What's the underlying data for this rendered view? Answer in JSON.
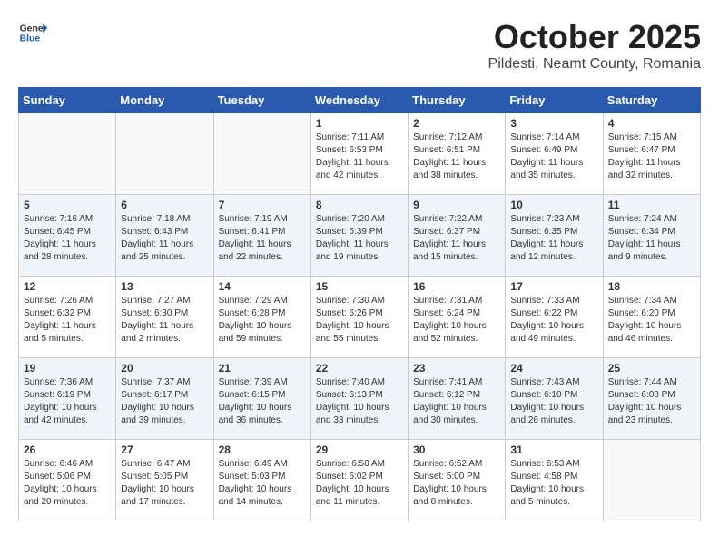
{
  "logo": {
    "general": "General",
    "blue": "Blue"
  },
  "title": "October 2025",
  "location": "Pildesti, Neamt County, Romania",
  "weekdays": [
    "Sunday",
    "Monday",
    "Tuesday",
    "Wednesday",
    "Thursday",
    "Friday",
    "Saturday"
  ],
  "weeks": [
    [
      {
        "day": "",
        "text": ""
      },
      {
        "day": "",
        "text": ""
      },
      {
        "day": "",
        "text": ""
      },
      {
        "day": "1",
        "text": "Sunrise: 7:11 AM\nSunset: 6:53 PM\nDaylight: 11 hours\nand 42 minutes."
      },
      {
        "day": "2",
        "text": "Sunrise: 7:12 AM\nSunset: 6:51 PM\nDaylight: 11 hours\nand 38 minutes."
      },
      {
        "day": "3",
        "text": "Sunrise: 7:14 AM\nSunset: 6:49 PM\nDaylight: 11 hours\nand 35 minutes."
      },
      {
        "day": "4",
        "text": "Sunrise: 7:15 AM\nSunset: 6:47 PM\nDaylight: 11 hours\nand 32 minutes."
      }
    ],
    [
      {
        "day": "5",
        "text": "Sunrise: 7:16 AM\nSunset: 6:45 PM\nDaylight: 11 hours\nand 28 minutes."
      },
      {
        "day": "6",
        "text": "Sunrise: 7:18 AM\nSunset: 6:43 PM\nDaylight: 11 hours\nand 25 minutes."
      },
      {
        "day": "7",
        "text": "Sunrise: 7:19 AM\nSunset: 6:41 PM\nDaylight: 11 hours\nand 22 minutes."
      },
      {
        "day": "8",
        "text": "Sunrise: 7:20 AM\nSunset: 6:39 PM\nDaylight: 11 hours\nand 19 minutes."
      },
      {
        "day": "9",
        "text": "Sunrise: 7:22 AM\nSunset: 6:37 PM\nDaylight: 11 hours\nand 15 minutes."
      },
      {
        "day": "10",
        "text": "Sunrise: 7:23 AM\nSunset: 6:35 PM\nDaylight: 11 hours\nand 12 minutes."
      },
      {
        "day": "11",
        "text": "Sunrise: 7:24 AM\nSunset: 6:34 PM\nDaylight: 11 hours\nand 9 minutes."
      }
    ],
    [
      {
        "day": "12",
        "text": "Sunrise: 7:26 AM\nSunset: 6:32 PM\nDaylight: 11 hours\nand 5 minutes."
      },
      {
        "day": "13",
        "text": "Sunrise: 7:27 AM\nSunset: 6:30 PM\nDaylight: 11 hours\nand 2 minutes."
      },
      {
        "day": "14",
        "text": "Sunrise: 7:29 AM\nSunset: 6:28 PM\nDaylight: 10 hours\nand 59 minutes."
      },
      {
        "day": "15",
        "text": "Sunrise: 7:30 AM\nSunset: 6:26 PM\nDaylight: 10 hours\nand 55 minutes."
      },
      {
        "day": "16",
        "text": "Sunrise: 7:31 AM\nSunset: 6:24 PM\nDaylight: 10 hours\nand 52 minutes."
      },
      {
        "day": "17",
        "text": "Sunrise: 7:33 AM\nSunset: 6:22 PM\nDaylight: 10 hours\nand 49 minutes."
      },
      {
        "day": "18",
        "text": "Sunrise: 7:34 AM\nSunset: 6:20 PM\nDaylight: 10 hours\nand 46 minutes."
      }
    ],
    [
      {
        "day": "19",
        "text": "Sunrise: 7:36 AM\nSunset: 6:19 PM\nDaylight: 10 hours\nand 42 minutes."
      },
      {
        "day": "20",
        "text": "Sunrise: 7:37 AM\nSunset: 6:17 PM\nDaylight: 10 hours\nand 39 minutes."
      },
      {
        "day": "21",
        "text": "Sunrise: 7:39 AM\nSunset: 6:15 PM\nDaylight: 10 hours\nand 36 minutes."
      },
      {
        "day": "22",
        "text": "Sunrise: 7:40 AM\nSunset: 6:13 PM\nDaylight: 10 hours\nand 33 minutes."
      },
      {
        "day": "23",
        "text": "Sunrise: 7:41 AM\nSunset: 6:12 PM\nDaylight: 10 hours\nand 30 minutes."
      },
      {
        "day": "24",
        "text": "Sunrise: 7:43 AM\nSunset: 6:10 PM\nDaylight: 10 hours\nand 26 minutes."
      },
      {
        "day": "25",
        "text": "Sunrise: 7:44 AM\nSunset: 6:08 PM\nDaylight: 10 hours\nand 23 minutes."
      }
    ],
    [
      {
        "day": "26",
        "text": "Sunrise: 6:46 AM\nSunset: 5:06 PM\nDaylight: 10 hours\nand 20 minutes."
      },
      {
        "day": "27",
        "text": "Sunrise: 6:47 AM\nSunset: 5:05 PM\nDaylight: 10 hours\nand 17 minutes."
      },
      {
        "day": "28",
        "text": "Sunrise: 6:49 AM\nSunset: 5:03 PM\nDaylight: 10 hours\nand 14 minutes."
      },
      {
        "day": "29",
        "text": "Sunrise: 6:50 AM\nSunset: 5:02 PM\nDaylight: 10 hours\nand 11 minutes."
      },
      {
        "day": "30",
        "text": "Sunrise: 6:52 AM\nSunset: 5:00 PM\nDaylight: 10 hours\nand 8 minutes."
      },
      {
        "day": "31",
        "text": "Sunrise: 6:53 AM\nSunset: 4:58 PM\nDaylight: 10 hours\nand 5 minutes."
      },
      {
        "day": "",
        "text": ""
      }
    ]
  ]
}
